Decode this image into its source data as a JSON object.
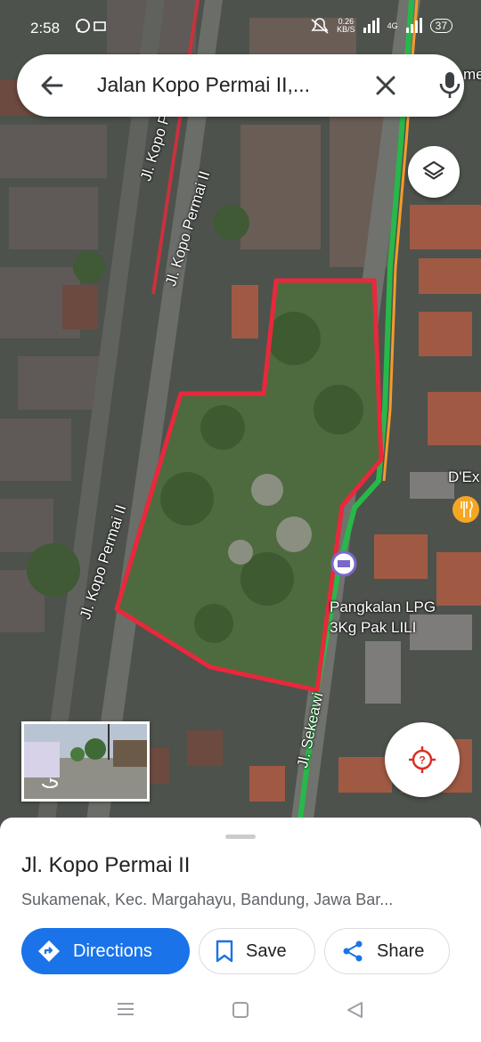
{
  "status_bar": {
    "time": "2:58",
    "net_speed_value": "0.26",
    "net_speed_unit": "KB/S",
    "network": "4G",
    "battery": "37"
  },
  "search": {
    "query": "Jalan Kopo Permai II,..."
  },
  "map": {
    "labels": {
      "road_1": "Jl. Kopo Permai",
      "road_2": "Jl. Kopo Permai II",
      "road_3": "Jl. Kopo Permai II",
      "road_4": "Jl. Sekeawi",
      "poi_1_line1": "Pangkalan LPG",
      "poi_1_line2": "3Kg Pak LILI",
      "poi_2": "D'Ex",
      "edge_text": "me"
    },
    "outline_color": "#e8283c"
  },
  "place": {
    "title": "Jl. Kopo Permai II",
    "address": "Sukamenak, Kec. Margahayu, Bandung, Jawa Bar..."
  },
  "actions": {
    "directions": "Directions",
    "save": "Save",
    "share": "Share"
  },
  "colors": {
    "primary": "#1a73e8"
  }
}
